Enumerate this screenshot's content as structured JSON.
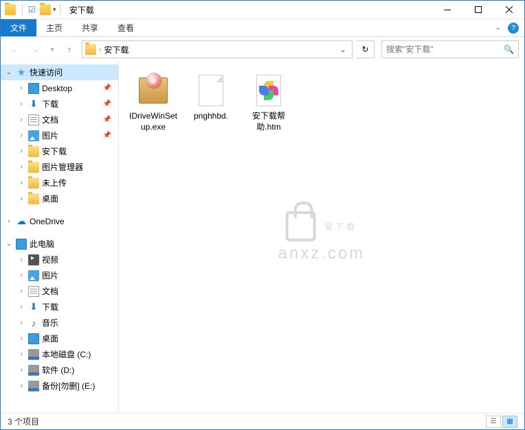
{
  "window": {
    "title": "安下载"
  },
  "ribbon": {
    "file": "文件",
    "tabs": [
      "主页",
      "共享",
      "查看"
    ]
  },
  "nav": {
    "path": "安下载",
    "search_placeholder": "搜索\"安下载\""
  },
  "sidebar": {
    "quick_access": "快速访问",
    "quick_items": [
      {
        "label": "Desktop",
        "icon": "desktop",
        "pinned": true
      },
      {
        "label": "下载",
        "icon": "downloads",
        "pinned": true
      },
      {
        "label": "文档",
        "icon": "docs",
        "pinned": true
      },
      {
        "label": "图片",
        "icon": "pics",
        "pinned": true
      },
      {
        "label": "安下载",
        "icon": "folder",
        "pinned": false
      },
      {
        "label": "图片管理器",
        "icon": "folder",
        "pinned": false
      },
      {
        "label": "未上传",
        "icon": "folder",
        "pinned": false
      },
      {
        "label": "桌面",
        "icon": "folder",
        "pinned": false
      }
    ],
    "onedrive": "OneDrive",
    "this_pc": "此电脑",
    "pc_items": [
      {
        "label": "视频",
        "icon": "video"
      },
      {
        "label": "图片",
        "icon": "pics"
      },
      {
        "label": "文档",
        "icon": "docs"
      },
      {
        "label": "下载",
        "icon": "downloads"
      },
      {
        "label": "音乐",
        "icon": "music"
      },
      {
        "label": "桌面",
        "icon": "desktop"
      },
      {
        "label": "本地磁盘 (C:)",
        "icon": "drive"
      },
      {
        "label": "软件 (D:)",
        "icon": "drive"
      },
      {
        "label": "备份[勿删] (E:)",
        "icon": "drive"
      }
    ]
  },
  "files": [
    {
      "name": "IDriveWinSetup.exe",
      "type": "exe"
    },
    {
      "name": "pnghhbd.",
      "type": "blank"
    },
    {
      "name": "安下载帮助.htm",
      "type": "htm"
    }
  ],
  "status": {
    "count": "3 个项目"
  },
  "watermark": {
    "top": "安下载",
    "bottom": "anxz.com"
  }
}
